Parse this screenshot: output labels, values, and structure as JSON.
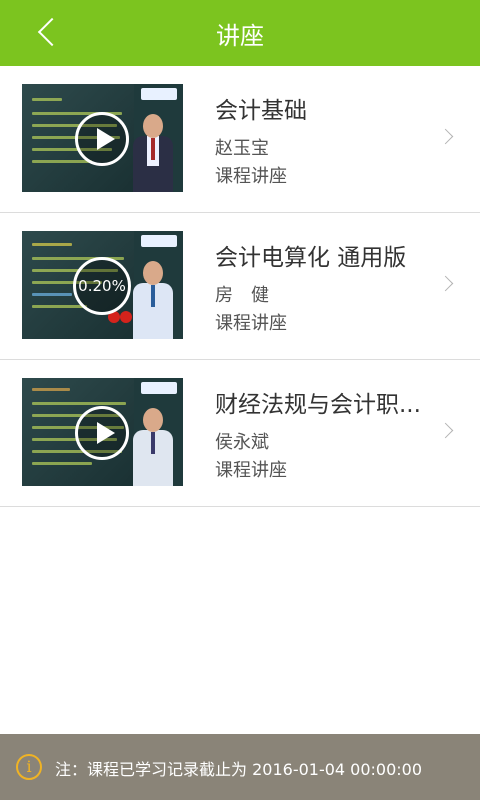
{
  "header": {
    "title": "讲座",
    "back_icon": "back-arrow-icon",
    "color": "#7cc41f"
  },
  "lectures": [
    {
      "title": "会计基础",
      "teacher": "赵玉宝",
      "category": "课程讲座",
      "overlay": "play"
    },
    {
      "title": "会计电算化 通用版",
      "teacher": "房　健",
      "category": "课程讲座",
      "overlay": "progress",
      "progress_text": "0.20%"
    },
    {
      "title": "财经法规与会计职...",
      "teacher": "侯永斌",
      "category": "课程讲座",
      "overlay": "play"
    }
  ],
  "footer": {
    "prefix": "注：",
    "notice": "课程已学习记录截止为 2016-01-04 00:00:00",
    "icon": "info-icon",
    "color": "#f0b324"
  }
}
